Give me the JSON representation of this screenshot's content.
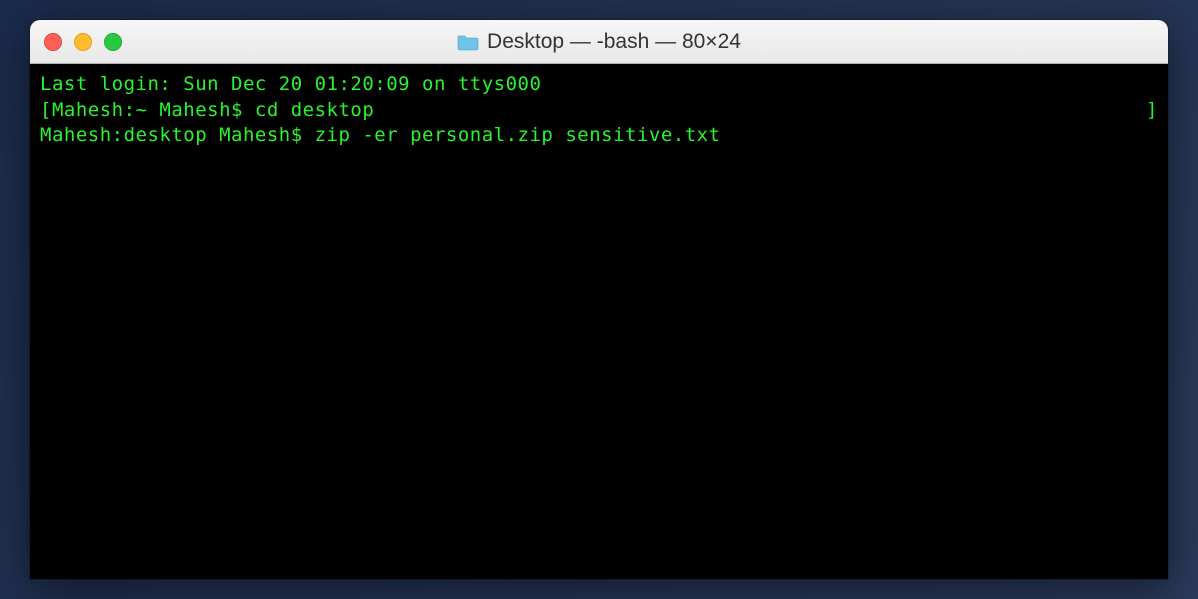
{
  "window": {
    "title": "Desktop — -bash — 80×24"
  },
  "terminal": {
    "lines": [
      "Last login: Sun Dec 20 01:20:09 on ttys000",
      "Mahesh:~ Mahesh$ cd desktop",
      "Mahesh:desktop Mahesh$ zip -er personal.zip sensitive.txt"
    ],
    "left_bracket": "[",
    "right_bracket": "]"
  },
  "icons": {
    "close": "close-icon",
    "minimize": "minimize-icon",
    "zoom": "zoom-icon",
    "folder": "folder-icon"
  }
}
